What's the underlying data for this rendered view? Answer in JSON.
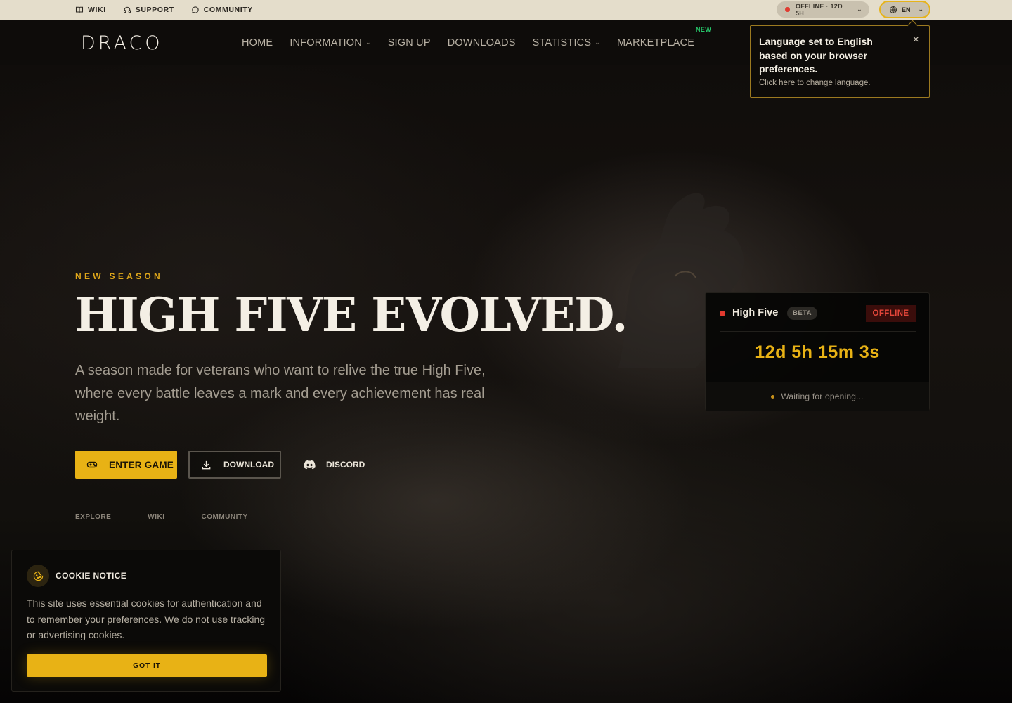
{
  "topbar": {
    "links": [
      {
        "label": "WIKI",
        "icon": "book-icon"
      },
      {
        "label": "SUPPORT",
        "icon": "headset-icon"
      },
      {
        "label": "COMMUNITY",
        "icon": "chat-bubble-icon"
      }
    ],
    "status_pill": "OFFLINE · 12D 5H",
    "language": "EN"
  },
  "nav": {
    "logo": "DRACO",
    "items": [
      {
        "label": "HOME"
      },
      {
        "label": "INFORMATION",
        "dropdown": true
      },
      {
        "label": "SIGN UP"
      },
      {
        "label": "DOWNLOADS"
      },
      {
        "label": "STATISTICS",
        "dropdown": true
      },
      {
        "label": "MARKETPLACE",
        "badge": "NEW"
      }
    ]
  },
  "lang_popover": {
    "message": "Language set to English based on your browser preferences.",
    "hint": "Click here to change language.",
    "close": "×"
  },
  "hero": {
    "eyebrow": "NEW SEASON",
    "title": "HIGH FIVE EVOLVED.",
    "description": "A season made for veterans who want to relive the true High Five, where every battle leaves a mark and every achievement has real weight.",
    "buttons": {
      "enter": "ENTER GAME",
      "download": "DOWNLOAD",
      "discord": "DISCORD"
    },
    "sub_links": [
      "EXPLORE",
      "WIKI",
      "COMMUNITY"
    ]
  },
  "server": {
    "name": "High Five",
    "tag": "BETA",
    "status": "OFFLINE",
    "countdown": "12d 5h 15m 3s",
    "footer": "Waiting for opening..."
  },
  "cookie": {
    "title": "COOKIE NOTICE",
    "text": "This site uses essential cookies for authentication and to remember your preferences. We do not use tracking or advertising cookies.",
    "button": "GOT IT"
  },
  "colors": {
    "accent": "#e8b215",
    "offline_red": "#e23a2f",
    "new_badge": "#27c56a",
    "topbar_bg": "#e4ddcb"
  }
}
